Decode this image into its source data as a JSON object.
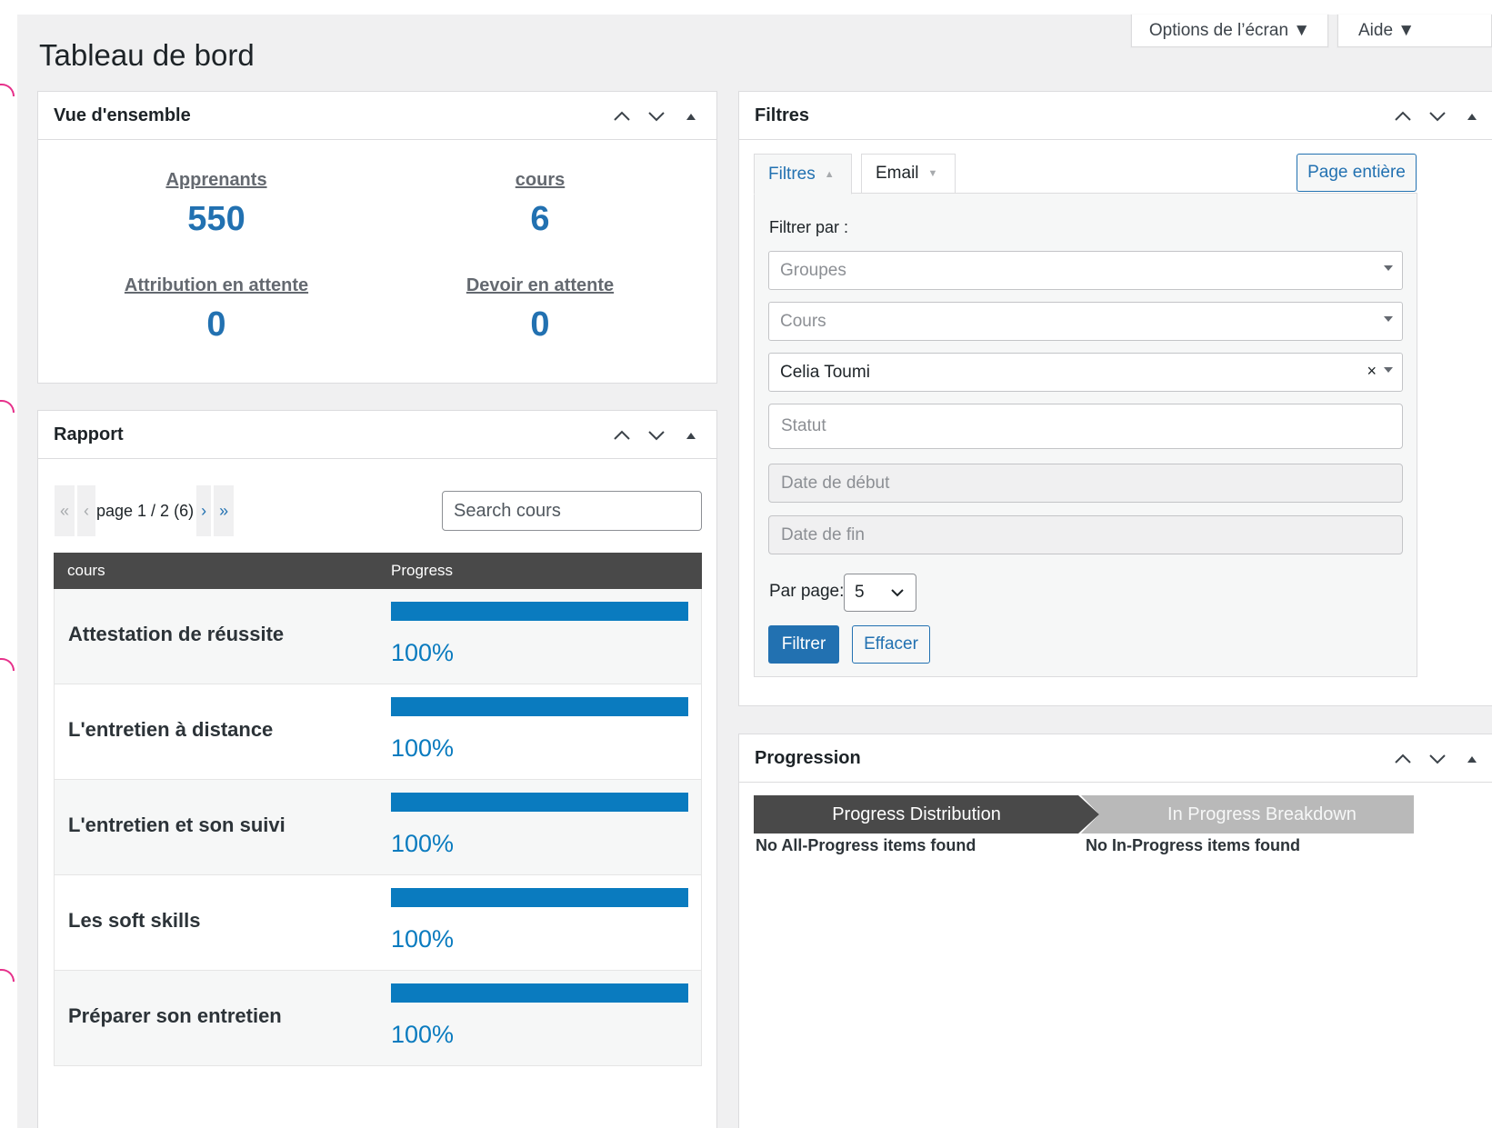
{
  "page": {
    "title": "Tableau de bord"
  },
  "screen_meta": {
    "options_label": "Options de l’écran ▼",
    "help_label": "Aide ▼"
  },
  "overview": {
    "title": "Vue d'ensemble",
    "stats": [
      {
        "label": "Apprenants",
        "value": "550"
      },
      {
        "label": "cours",
        "value": "6"
      },
      {
        "label": "Attribution en attente",
        "value": "0"
      },
      {
        "label": "Devoir en attente",
        "value": "0"
      }
    ]
  },
  "report": {
    "title": "Rapport",
    "pager": {
      "first": "«",
      "prev": "‹",
      "text": "page 1 / 2 (6)",
      "next": "›",
      "last": "»"
    },
    "search_placeholder": "Search cours",
    "columns": [
      "cours",
      "Progress"
    ],
    "rows": [
      {
        "course": "Attestation de réussite",
        "progress": 1.0,
        "progress_label": "100%"
      },
      {
        "course": "L'entretien à distance",
        "progress": 1.0,
        "progress_label": "100%"
      },
      {
        "course": "L'entretien et son suivi",
        "progress": 1.0,
        "progress_label": "100%"
      },
      {
        "course": "Les soft skills",
        "progress": 1.0,
        "progress_label": "100%"
      },
      {
        "course": "Préparer son entretien",
        "progress": 1.0,
        "progress_label": "100%"
      }
    ]
  },
  "filters": {
    "title": "Filtres",
    "tabs": [
      {
        "label": "Filtres",
        "arrow": "▲"
      },
      {
        "label": "Email",
        "arrow": "▼"
      }
    ],
    "fullpage_label": "Page entière",
    "filter_by_label": "Filtrer par :",
    "groups_placeholder": "Groupes",
    "courses_placeholder": "Cours",
    "user_value": "Celia Toumi",
    "user_clear": "×",
    "status_placeholder": "Statut",
    "start_date_placeholder": "Date de début",
    "end_date_placeholder": "Date de fin",
    "per_page_label": "Par page:",
    "per_page_value": "5",
    "filter_button": "Filtrer",
    "clear_button": "Effacer"
  },
  "progression": {
    "title": "Progression",
    "tab_distribution": "Progress Distribution",
    "tab_breakdown": "In Progress Breakdown",
    "msg_all": "No All-Progress items found",
    "msg_in": "No In-Progress items found"
  },
  "colors": {
    "accent": "#2271b1",
    "progress_fill": "#0a7bbf",
    "table_header": "#494949",
    "annotation_mark": "#e6308a"
  }
}
